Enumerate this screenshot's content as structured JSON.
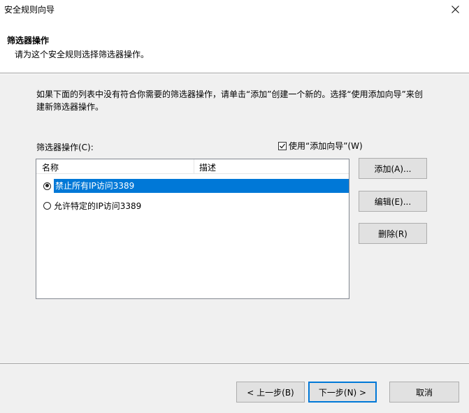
{
  "window": {
    "title": "安全规则向导"
  },
  "header": {
    "title": "筛选器操作",
    "subtitle": "请为这个安全规则选择筛选器操作。"
  },
  "content": {
    "description": "如果下面的列表中没有符合你需要的筛选器操作，请单击“添加”创建一个新的。选择“使用添加向导”来创建新筛选器操作。",
    "list_label": "筛选器操作(C):",
    "wizard_checkbox": {
      "label": "使用“添加向导”(W)",
      "checked": true
    },
    "columns": {
      "name": "名称",
      "description": "描述"
    },
    "rows": [
      {
        "name": "禁止所有IP访问3389",
        "description": "",
        "selected": true
      },
      {
        "name": "允许特定的IP访问3389",
        "description": "",
        "selected": false
      }
    ]
  },
  "buttons": {
    "add": "添加(A)...",
    "edit": "编辑(E)...",
    "remove": "删除(R)",
    "back": "< 上一步(B)",
    "next": "下一步(N) >",
    "cancel": "取消"
  },
  "colors": {
    "selection": "#0078d7",
    "panel": "#f0f0f0"
  }
}
